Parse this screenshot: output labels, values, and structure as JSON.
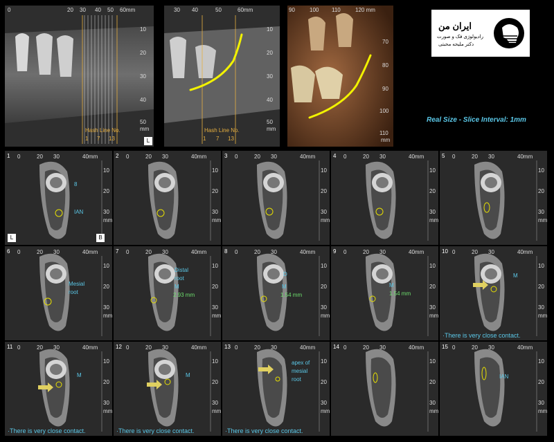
{
  "panoramic": {
    "panel1": {
      "ruler_top": [
        "0",
        "20",
        "30",
        "40",
        "50",
        "60mm"
      ],
      "ruler_right": [
        "10",
        "20",
        "30",
        "40",
        "50",
        "mm"
      ],
      "hash_label": "Hash Line No.",
      "hash_numbers": [
        "1",
        "7",
        "13"
      ],
      "side_label": "L"
    },
    "panel2": {
      "ruler_top": [
        "30",
        "40",
        "50",
        "60mm"
      ],
      "ruler_right": [
        "10",
        "20",
        "30",
        "40",
        "50",
        "mm"
      ],
      "hash_label": "Hash Line No.",
      "hash_numbers": [
        "1",
        "7",
        "13"
      ]
    },
    "panel3": {
      "ruler_top": [
        "90",
        "100",
        "110",
        "120 mm"
      ],
      "ruler_right": [
        "70",
        "80",
        "90",
        "100",
        "110",
        "mm"
      ]
    }
  },
  "logo": {
    "name": "ایران من",
    "line1": "رادیولوژی فک و صورت",
    "line2": "دکتر ملیحه محبتی"
  },
  "info": {
    "real_size": "Real Size  -  Slice Interval: 1mm"
  },
  "slice_ruler": {
    "top": [
      "0",
      "20",
      "30",
      "40mm"
    ],
    "right": [
      "10",
      "20",
      "30",
      "mm"
    ]
  },
  "slices": [
    {
      "num": "1",
      "labels": [
        {
          "t": "8",
          "c": "b"
        },
        {
          "t": "IAN",
          "c": "b"
        }
      ],
      "corner_L": "L",
      "corner_B": "B",
      "contact": ""
    },
    {
      "num": "2",
      "labels": [],
      "contact": ""
    },
    {
      "num": "3",
      "labels": [],
      "contact": ""
    },
    {
      "num": "4",
      "labels": [],
      "contact": ""
    },
    {
      "num": "5",
      "labels": [],
      "contact": ""
    },
    {
      "num": "6",
      "labels": [
        {
          "t": "Mesial",
          "c": "b"
        },
        {
          "t": "root",
          "c": "b"
        }
      ],
      "contact": ""
    },
    {
      "num": "7",
      "labels": [
        {
          "t": "Distal",
          "c": "b"
        },
        {
          "t": "root",
          "c": "b"
        },
        {
          "t": "M",
          "c": "b"
        },
        {
          "t": "2.93 mm",
          "c": "g"
        }
      ],
      "contact": ""
    },
    {
      "num": "8",
      "labels": [
        {
          "t": "D",
          "c": "b"
        },
        {
          "t": "M",
          "c": "b"
        },
        {
          "t": "1.54 mm",
          "c": "g"
        }
      ],
      "contact": ""
    },
    {
      "num": "9",
      "labels": [
        {
          "t": "M",
          "c": "b"
        },
        {
          "t": "1.54 mm",
          "c": "g"
        }
      ],
      "contact": ""
    },
    {
      "num": "10",
      "labels": [
        {
          "t": "M",
          "c": "b"
        }
      ],
      "contact": "There is very close contact."
    },
    {
      "num": "11",
      "labels": [
        {
          "t": "M",
          "c": "b"
        }
      ],
      "contact": "There is very close contact."
    },
    {
      "num": "12",
      "labels": [
        {
          "t": "M",
          "c": "b"
        }
      ],
      "contact": "There is very close contact."
    },
    {
      "num": "13",
      "labels": [
        {
          "t": "apex of",
          "c": "b"
        },
        {
          "t": "mesial",
          "c": "b"
        },
        {
          "t": "root",
          "c": "b"
        }
      ],
      "contact": "There is very close contact."
    },
    {
      "num": "14",
      "labels": [],
      "contact": ""
    },
    {
      "num": "15",
      "labels": [
        {
          "t": "IAN",
          "c": "b"
        }
      ],
      "contact": ""
    }
  ]
}
